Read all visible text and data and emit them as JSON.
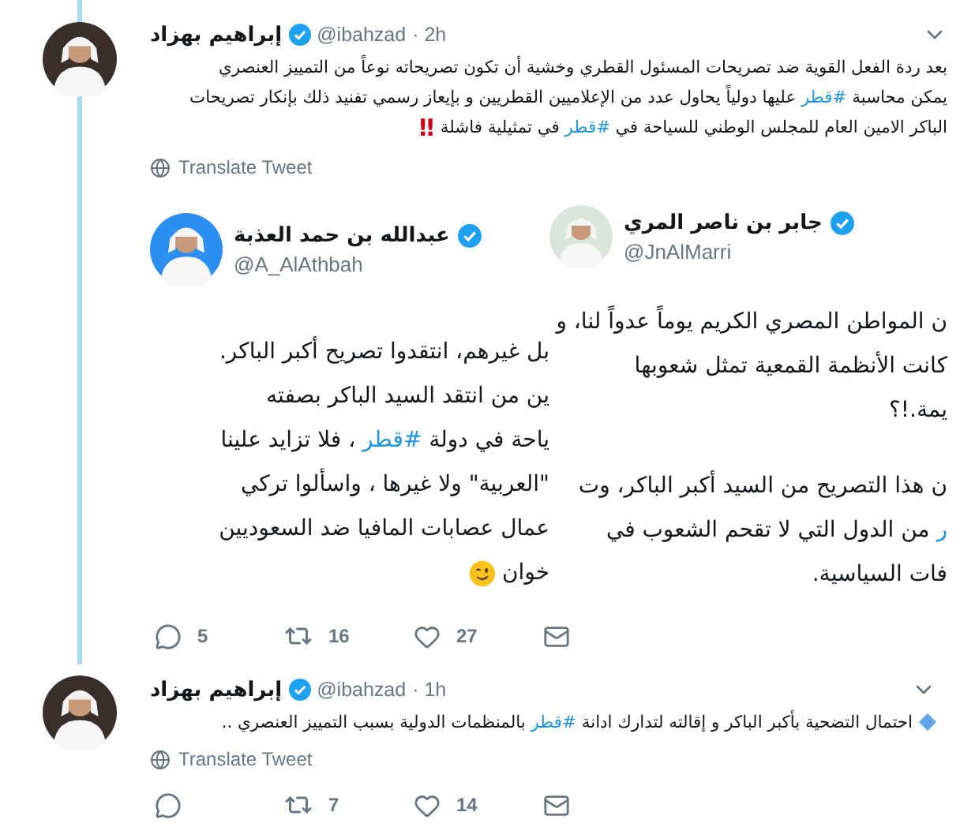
{
  "tweets": [
    {
      "author": "إبراهيم بهزاد",
      "verified": true,
      "handle": "@ibahzad",
      "time": "· 2h",
      "thread_above": true,
      "thread_below": true,
      "body": [
        [
          {
            "kind": "text",
            "text": "بعد ردة الفعل القوية ضد تصريحات المسئول القطري وخشية أن تكون تصريحاته نوعاً من التمييز العنصري"
          }
        ],
        [
          {
            "kind": "text",
            "text": "يمكن محاسبة "
          },
          {
            "kind": "hashtag",
            "text": "#قطر"
          },
          {
            "kind": "text",
            "text": " عليها دولياً يحاول عدد من الإعلاميين القطريين و بإيعاز رسمي تفنيد ذلك بإنكار تصريحات"
          }
        ],
        [
          {
            "kind": "text",
            "text": "الباكر الامين العام للمجلس الوطني للسياحة في "
          },
          {
            "kind": "hashtag",
            "text": "#قطر"
          },
          {
            "kind": "text",
            "text": " في تمثيلية فاشلة"
          },
          {
            "kind": "mark",
            "text": "‼"
          }
        ]
      ],
      "translate": "Translate Tweet",
      "image": {
        "cards": [
          {
            "author": "جابر بن ناصر المري",
            "verified": true,
            "handle": "@JnAlMarri",
            "paragraphs": [
              [
                [
                  {
                    "kind": "text",
                    "text": "ن المواطن المصري الكريم يوماً عدواً لنا، و"
                  }
                ],
                [
                  {
                    "kind": "text",
                    "text": "كانت الأنظمة القمعية تمثل شعوبها"
                  }
                ],
                [
                  {
                    "kind": "text",
                    "text": "يمة.!؟"
                  }
                ]
              ],
              [
                [
                  {
                    "kind": "text",
                    "text": "ن هذا التصريح من السيد أكبر الباكر، وت"
                  }
                ],
                [
                  {
                    "kind": "hashtag",
                    "text": "ر"
                  },
                  {
                    "kind": "text",
                    "text": " من الدول التي لا تقحم الشعوب في"
                  }
                ],
                [
                  {
                    "kind": "text",
                    "text": "فات السياسية."
                  }
                ]
              ]
            ]
          },
          {
            "author": "عبدالله بن حمد العذبة",
            "verified": true,
            "handle": "@A_AlAthbah",
            "paragraphs": [
              [
                [
                  {
                    "kind": "text",
                    "text": "بل غيرهم، انتقدوا تصريح أكبر الباكر."
                  }
                ],
                [
                  {
                    "kind": "text",
                    "text": "ين من انتقد السيد الباكر بصفته"
                  }
                ],
                [
                  {
                    "kind": "text",
                    "text": "ياحة في دولة "
                  },
                  {
                    "kind": "hashtag",
                    "text": "#قطر"
                  },
                  {
                    "kind": "text",
                    "text": " ، فلا تزايد علينا"
                  }
                ],
                [
                  {
                    "kind": "text",
                    "text": "\"العربية\" ولا غيرها ، واسألوا تركي"
                  }
                ],
                [
                  {
                    "kind": "text",
                    "text": "عمال عصابات المافيا ضد السعوديين"
                  }
                ],
                [
                  {
                    "kind": "text",
                    "text": "خوان"
                  },
                  {
                    "kind": "emoji"
                  }
                ]
              ]
            ]
          }
        ]
      },
      "actions": {
        "replies": "5",
        "retweets": "16",
        "likes": "27"
      }
    },
    {
      "author": "إبراهيم بهزاد",
      "verified": true,
      "handle": "@ibahzad",
      "time": "· 1h",
      "body": [
        [
          {
            "kind": "diamond"
          },
          {
            "kind": "text",
            "text": "احتمال التضحية بأكبر الباكر و إقالته لتدارك ادانة "
          },
          {
            "kind": "hashtag",
            "text": "#قطر"
          },
          {
            "kind": "text",
            "text": "  بالمنظمات الدولية بسبب التمييز العنصري .."
          }
        ]
      ],
      "translate": "Translate Tweet",
      "actions": {
        "retweets": "7",
        "likes": "14"
      }
    }
  ]
}
